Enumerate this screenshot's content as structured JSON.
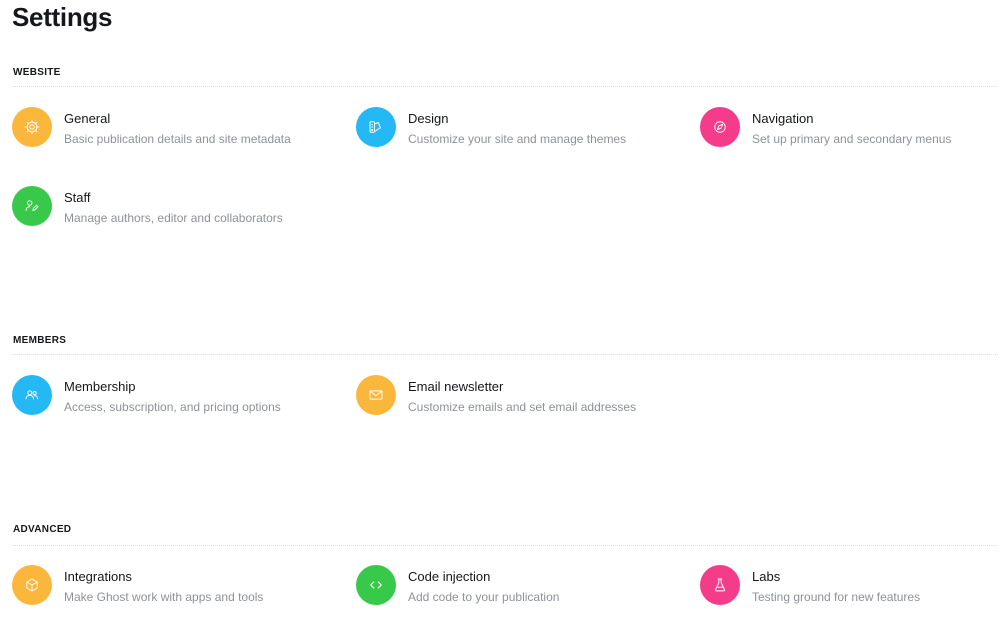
{
  "page": {
    "title": "Settings"
  },
  "colors": {
    "yellow": "#fbb73b",
    "blue": "#24b8f5",
    "pink": "#f43c8a",
    "green": "#38c84a"
  },
  "sections": {
    "website": {
      "label": "WEBSITE",
      "items": [
        {
          "title": "General",
          "description": "Basic publication details and site metadata",
          "icon": "gear-icon",
          "color": "yellow"
        },
        {
          "title": "Design",
          "description": "Customize your site and manage themes",
          "icon": "palette-icon",
          "color": "blue"
        },
        {
          "title": "Navigation",
          "description": "Set up primary and secondary menus",
          "icon": "compass-icon",
          "color": "pink"
        },
        {
          "title": "Staff",
          "description": "Manage authors, editor and collaborators",
          "icon": "user-edit-icon",
          "color": "green"
        }
      ]
    },
    "members": {
      "label": "MEMBERS",
      "items": [
        {
          "title": "Membership",
          "description": "Access, subscription, and pricing options",
          "icon": "users-icon",
          "color": "blue"
        },
        {
          "title": "Email newsletter",
          "description": "Customize emails and set email addresses",
          "icon": "envelope-icon",
          "color": "yellow"
        }
      ]
    },
    "advanced": {
      "label": "ADVANCED",
      "items": [
        {
          "title": "Integrations",
          "description": "Make Ghost work with apps and tools",
          "icon": "cube-icon",
          "color": "yellow"
        },
        {
          "title": "Code injection",
          "description": "Add code to your publication",
          "icon": "code-icon",
          "color": "green"
        },
        {
          "title": "Labs",
          "description": "Testing ground for new features",
          "icon": "flask-icon",
          "color": "pink"
        }
      ]
    }
  }
}
